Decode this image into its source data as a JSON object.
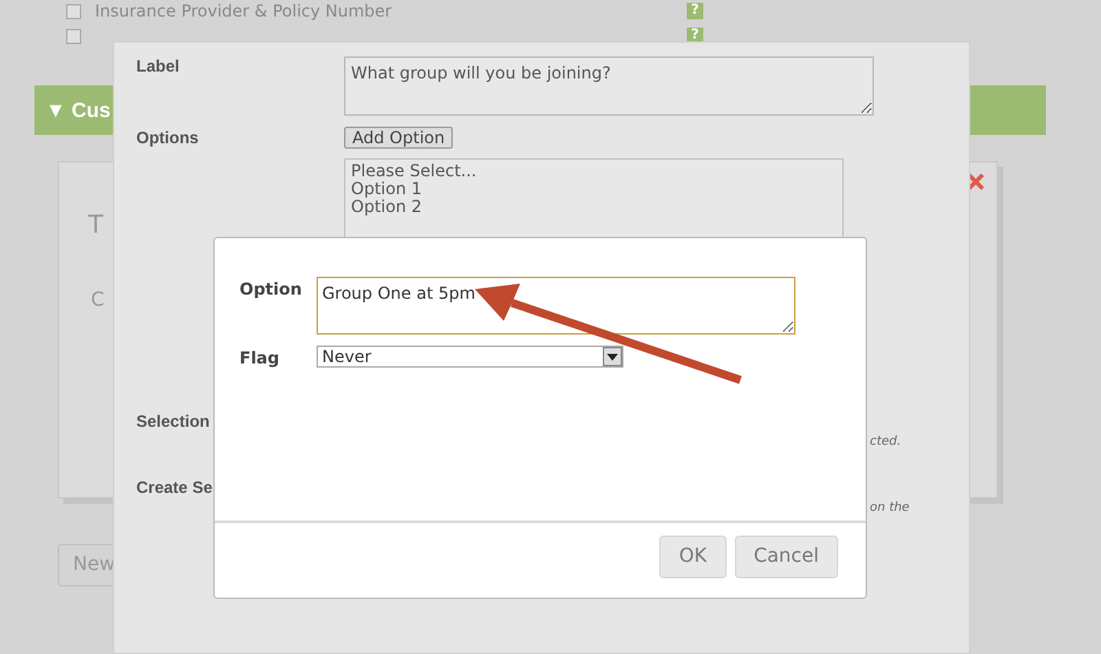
{
  "background": {
    "checklist": [
      {
        "label": "Insurance Provider & Policy Number",
        "checked": false,
        "help": "?"
      },
      {
        "checked": false,
        "help": "?"
      }
    ],
    "section_header": "▼ Cus",
    "card_fragments": [
      "T",
      "C"
    ],
    "new_button": "New"
  },
  "field_dialog": {
    "fields": [
      {
        "label": "Label",
        "kind": "textarea",
        "value": "What group will you be joining?"
      },
      {
        "label": "Options",
        "kind": "options",
        "button": "Add Option",
        "items": [
          "Please Select...",
          "Option 1",
          "Option 2"
        ]
      },
      {
        "label": "Selection",
        "kind": "note",
        "note": "cted."
      },
      {
        "label": "Create Se",
        "kind": "note",
        "note": "on the"
      }
    ]
  },
  "option_dialog": {
    "fields": [
      {
        "label": "Option",
        "kind": "textarea",
        "value": "Group One at 5pm",
        "focused": true
      },
      {
        "label": "Flag",
        "kind": "select",
        "value": "Never"
      }
    ],
    "buttons": [
      "OK",
      "Cancel"
    ]
  }
}
